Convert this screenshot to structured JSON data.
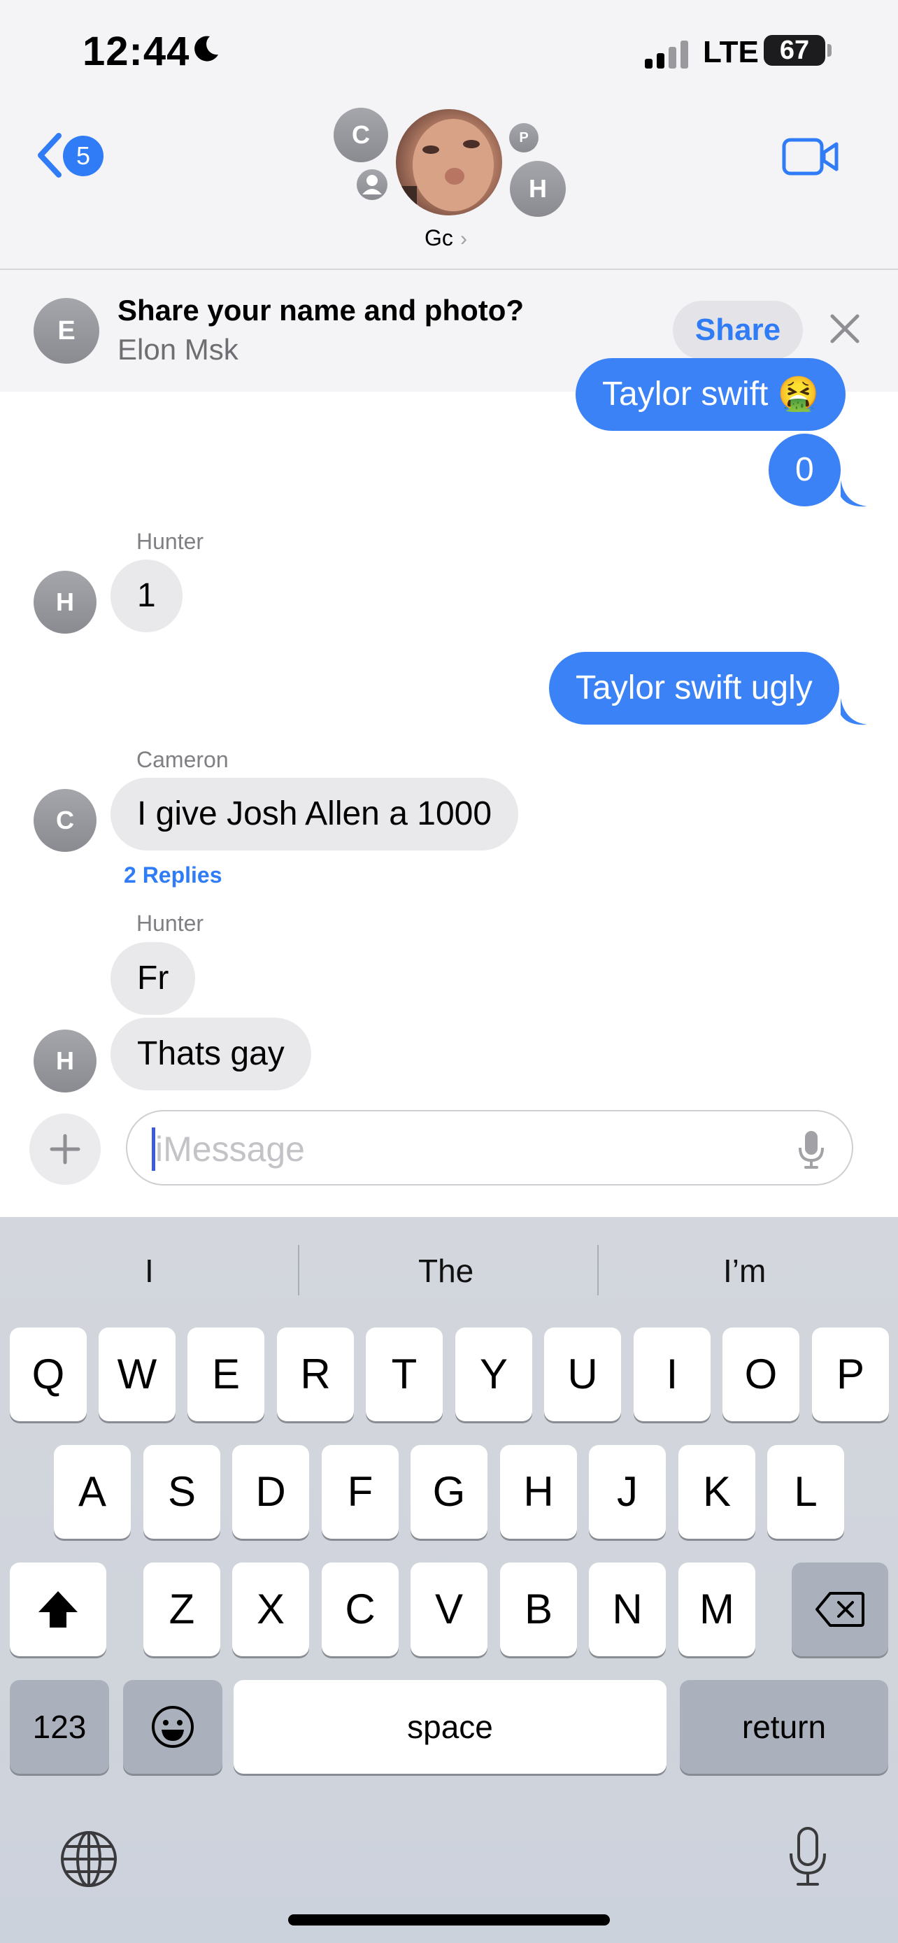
{
  "status_bar": {
    "time": "12:44",
    "network": "LTE",
    "battery": "67"
  },
  "header": {
    "back_badge": "5",
    "group_name": "Gc",
    "avatars": {
      "c": "C",
      "p": "P",
      "h": "H"
    }
  },
  "share_banner": {
    "avatar": "E",
    "title": "Share your name and photo?",
    "subtitle": "Elon Msk",
    "share_label": "Share"
  },
  "messages": [
    {
      "sender": "",
      "text": "Taylor swift 🤮",
      "outgoing": true
    },
    {
      "sender": "",
      "text": "0",
      "outgoing": true
    },
    {
      "sender": "Hunter",
      "avatar": "H",
      "text": "1",
      "outgoing": false
    },
    {
      "sender": "",
      "text": "Taylor swift ugly",
      "outgoing": true
    },
    {
      "sender": "Cameron",
      "avatar": "C",
      "text": "I give Josh Allen a 1000",
      "outgoing": false,
      "replies": "2 Replies"
    },
    {
      "sender": "Hunter",
      "text": "Fr",
      "outgoing": false
    },
    {
      "sender": "",
      "avatar": "H",
      "text": "Thats gay",
      "outgoing": false
    }
  ],
  "input": {
    "placeholder": "iMessage"
  },
  "keyboard": {
    "suggestions": [
      "I",
      "The",
      "I’m"
    ],
    "row1": [
      "Q",
      "W",
      "E",
      "R",
      "T",
      "Y",
      "U",
      "I",
      "O",
      "P"
    ],
    "row2": [
      "A",
      "S",
      "D",
      "F",
      "G",
      "H",
      "J",
      "K",
      "L"
    ],
    "row3": [
      "Z",
      "X",
      "C",
      "V",
      "B",
      "N",
      "M"
    ],
    "numbers_label": "123",
    "space_label": "space",
    "return_label": "return"
  },
  "colors": {
    "accent": "#2f7cf6",
    "outgoing_bubble": "#3b82f6",
    "incoming_bubble": "#e9e9eb"
  }
}
